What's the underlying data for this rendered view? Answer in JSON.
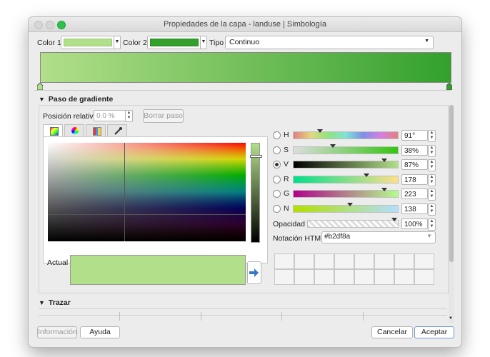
{
  "window": {
    "title": "Propiedades de la capa - landuse | Simbología"
  },
  "top": {
    "color1_label": "Color 1",
    "color1_value": "#b2df8a",
    "color2_label": "Color 2",
    "color2_value": "#33a02c",
    "type_label": "Tipo",
    "type_value": "Continuo"
  },
  "gradient_step": {
    "title": "Paso de gradiente",
    "relative_position_label": "Posición relativa",
    "relative_position_placeholder": "0.0 %",
    "delete_step": "Borrar paso"
  },
  "tabs": [
    "color-ramp-icon",
    "color-wheel-icon",
    "color-swatches-icon",
    "color-picker-icon"
  ],
  "channels": [
    {
      "key": "H",
      "value": "91°",
      "level": 0.25
    },
    {
      "key": "S",
      "value": "38%",
      "level": 0.38
    },
    {
      "key": "V",
      "value": "87%",
      "level": 0.87
    },
    {
      "key": "R",
      "value": "178",
      "level": 0.7
    },
    {
      "key": "G",
      "value": "223",
      "level": 0.87
    },
    {
      "key": "N",
      "value": "138",
      "level": 0.54
    }
  ],
  "opacity": {
    "label": "Opacidad",
    "value": "100%"
  },
  "html_notation": {
    "label": "Notación HTML",
    "value": "#b2df8a"
  },
  "current": {
    "label": "Actual",
    "color": "#b2df8a"
  },
  "stroke": {
    "title": "Trazar"
  },
  "buttons": {
    "info": "Información",
    "help": "Ayuda",
    "cancel": "Cancelar",
    "accept": "Aceptar"
  }
}
